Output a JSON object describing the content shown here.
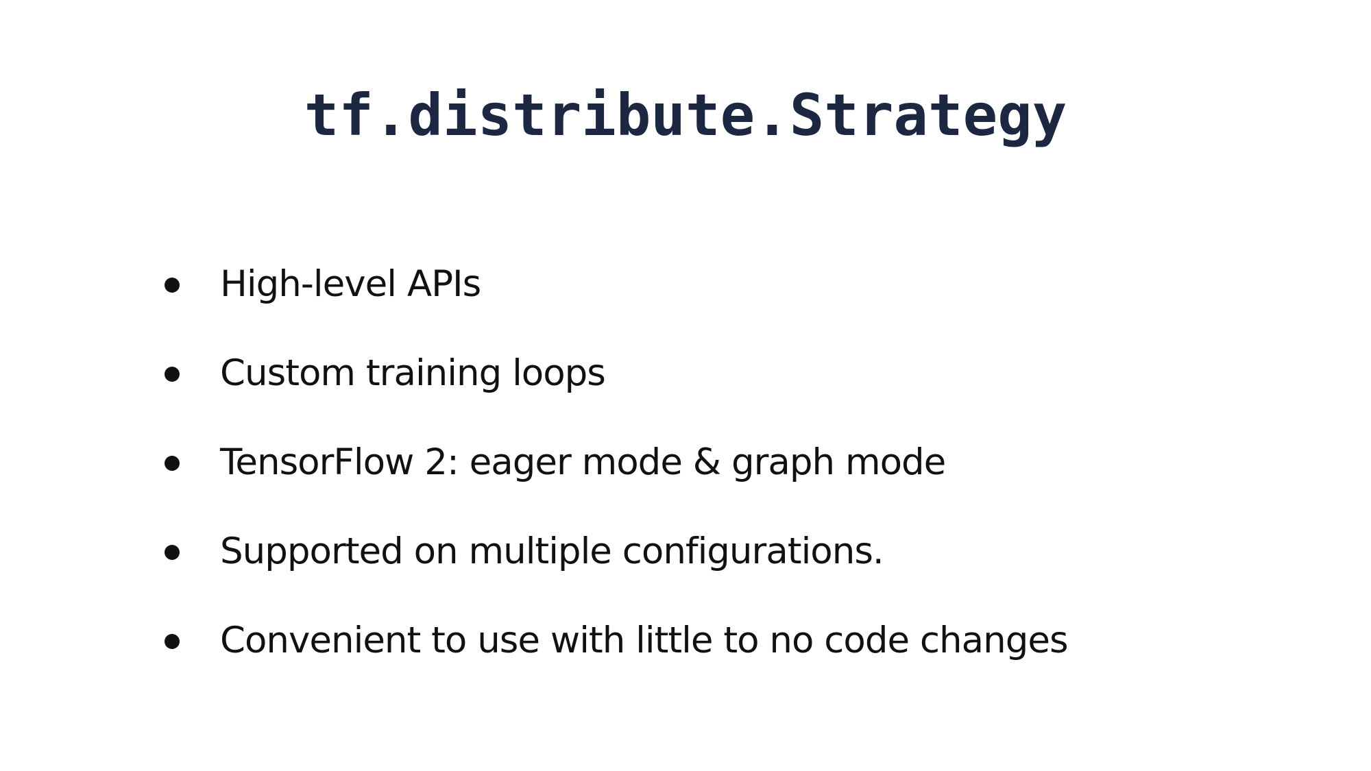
{
  "slide": {
    "title": "tf.distribute.Strategy",
    "bullets": [
      "High-level APIs",
      "Custom training loops",
      "TensorFlow 2: eager mode & graph mode",
      "Supported on multiple configurations.",
      "Convenient to use with little to no code changes"
    ]
  },
  "colors": {
    "title": "#1c2742",
    "text": "#111111",
    "background": "#ffffff"
  }
}
